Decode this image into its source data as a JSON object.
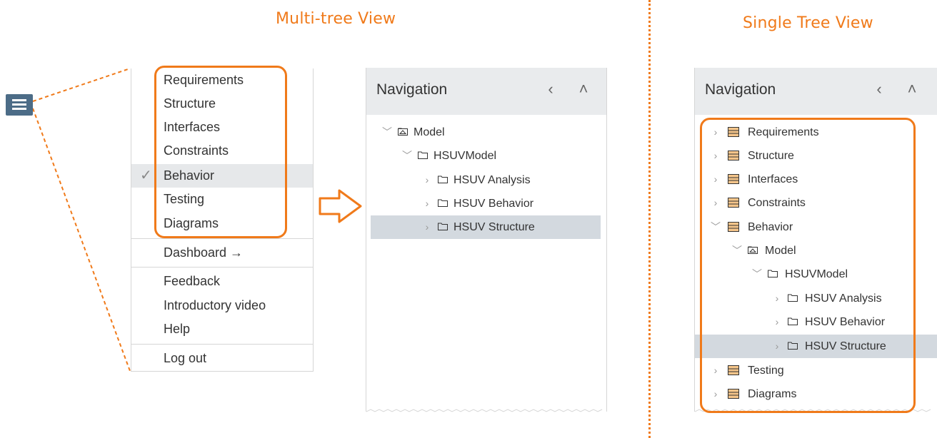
{
  "titles": {
    "multi": "Multi-tree View",
    "single": "Single Tree View"
  },
  "menu": {
    "items": [
      {
        "label": "Requirements"
      },
      {
        "label": "Structure"
      },
      {
        "label": "Interfaces"
      },
      {
        "label": "Constraints"
      },
      {
        "label": "Behavior",
        "checked": true
      },
      {
        "label": "Testing"
      },
      {
        "label": "Diagrams"
      }
    ],
    "dashboard": "Dashboard →",
    "feedback": "Feedback",
    "intro_video": "Introductory video",
    "help": "Help",
    "logout": "Log out",
    "check_icon": "✓"
  },
  "multi_nav": {
    "title": "Navigation",
    "back_icon": "‹",
    "collapse_icon": "˄",
    "rows": [
      {
        "label": "Model"
      },
      {
        "label": "HSUVModel"
      },
      {
        "label": "HSUV Analysis"
      },
      {
        "label": "HSUV Behavior"
      },
      {
        "label": "HSUV Structure",
        "selected": true
      }
    ]
  },
  "single_nav": {
    "title": "Navigation",
    "back_icon": "‹",
    "collapse_icon": "˄",
    "rows": [
      {
        "label": "Requirements"
      },
      {
        "label": "Structure"
      },
      {
        "label": "Interfaces"
      },
      {
        "label": "Constraints"
      },
      {
        "label": "Behavior"
      },
      {
        "label": "Model"
      },
      {
        "label": "HSUVModel"
      },
      {
        "label": "HSUV Analysis"
      },
      {
        "label": "HSUV Behavior"
      },
      {
        "label": "HSUV Structure",
        "selected": true
      },
      {
        "label": "Testing"
      },
      {
        "label": "Diagrams"
      }
    ]
  },
  "colors": {
    "accent": "#f07a1a",
    "hamburger": "#4c6c87",
    "header_bg": "#e9ebed",
    "selected_bg": "#d3d9df"
  }
}
